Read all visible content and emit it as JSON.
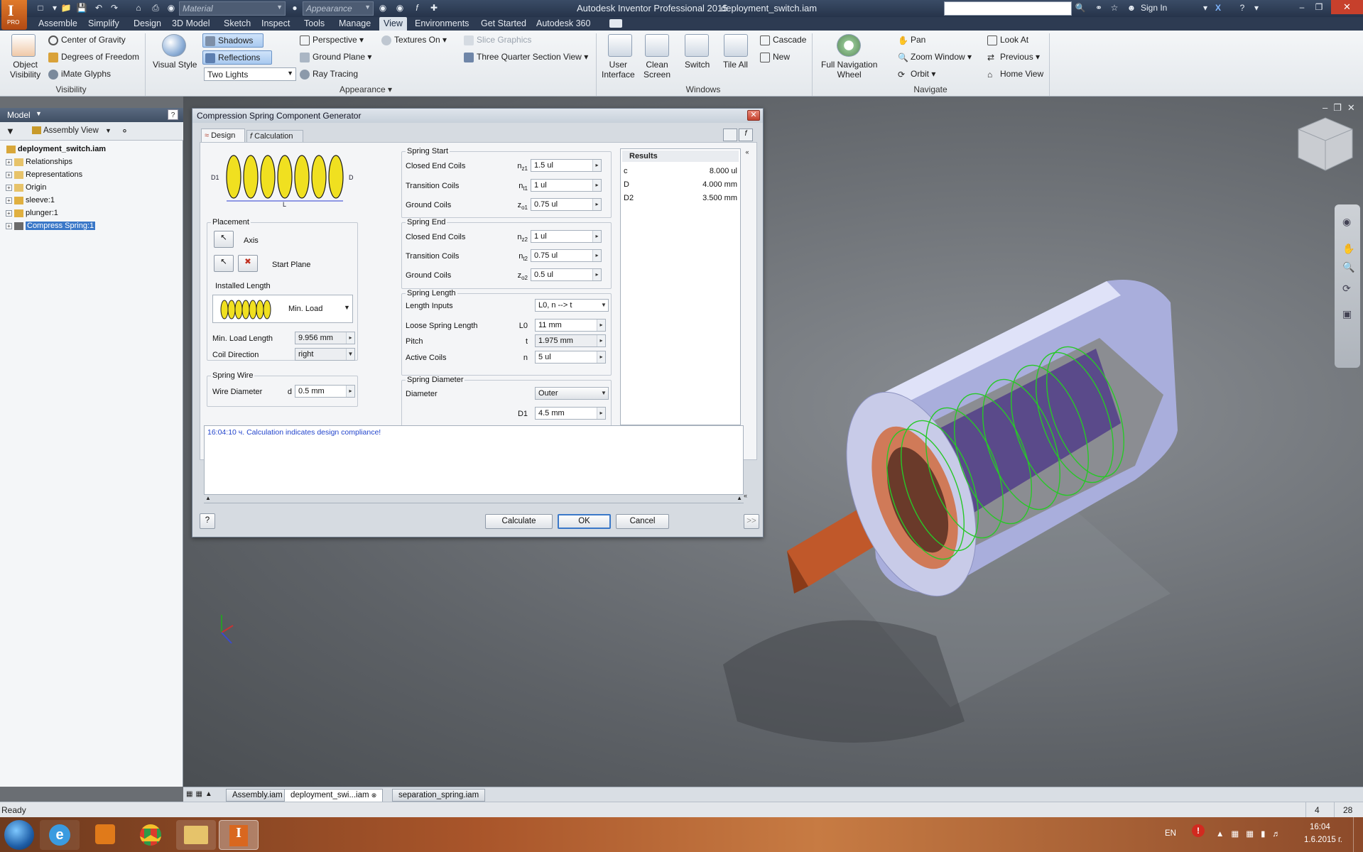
{
  "titlebar": {
    "app_title": "Autodesk Inventor Professional 2015",
    "file_title": "deployment_switch.iam",
    "material_combo": "Material",
    "appearance_combo": "Appearance",
    "sign_in": "Sign In",
    "pro_badge": "PRO"
  },
  "menu": [
    "Assemble",
    "Simplify",
    "Design",
    "3D Model",
    "Sketch",
    "Inspect",
    "Tools",
    "Manage",
    "View",
    "Environments",
    "Get Started",
    "Autodesk 360"
  ],
  "ribbon": {
    "object_visibility": "Object\nVisibility",
    "center_of_gravity": "Center of Gravity",
    "degrees_of_freedom": "Degrees of Freedom",
    "imate_glyphs": "iMate Glyphs",
    "visibility_group": "Visibility",
    "visual_style": "Visual Style",
    "shadows": "Shadows",
    "reflections": "Reflections",
    "lighting": "Two Lights",
    "perspective": "Perspective",
    "ground_plane": "Ground Plane",
    "ray_tracing": "Ray Tracing",
    "textures_on": "Textures On",
    "slice_graphics": "Slice Graphics",
    "three_quarter": "Three Quarter Section View",
    "appearance_group": "Appearance",
    "user_interface": "User\nInterface",
    "clean_screen": "Clean\nScreen",
    "switch": "Switch",
    "tile_all": "Tile All",
    "cascade": "Cascade",
    "new": "New",
    "windows_group": "Windows",
    "full_nav_wheel": "Full Navigation\nWheel",
    "pan": "Pan",
    "zoom_window": "Zoom Window",
    "orbit": "Orbit",
    "look_at": "Look At",
    "previous": "Previous",
    "home_view": "Home View",
    "navigate_group": "Navigate"
  },
  "browser": {
    "header": "Model",
    "view_mode": "Assembly View",
    "root": "deployment_switch.iam",
    "items": [
      "Relationships",
      "Representations",
      "Origin",
      "sleeve:1",
      "plunger:1",
      "Compress Spring:1"
    ]
  },
  "dialog": {
    "title": "Compression Spring Component Generator",
    "tab_design": "Design",
    "tab_calculation": "Calculation",
    "placement": "Placement",
    "axis": "Axis",
    "start_plane": "Start Plane",
    "installed_length": "Installed Length",
    "min_load": "Min. Load",
    "min_load_length_label": "Min. Load Length",
    "min_load_length_value": "9.956 mm",
    "coil_direction_label": "Coil Direction",
    "coil_direction_value": "right",
    "spring_wire": "Spring Wire",
    "wire_diameter_label": "Wire Diameter",
    "wire_diameter_sym": "d",
    "wire_diameter_value": "0.5 mm",
    "spring_start": "Spring Start",
    "start_rows": [
      {
        "label": "Closed End Coils",
        "sym": "n",
        "sub": "z1",
        "value": "1.5 ul"
      },
      {
        "label": "Transition Coils",
        "sym": "n",
        "sub": "t1",
        "value": "1 ul"
      },
      {
        "label": "Ground Coils",
        "sym": "z",
        "sub": "o1",
        "value": "0.75 ul"
      }
    ],
    "spring_end": "Spring End",
    "end_rows": [
      {
        "label": "Closed End Coils",
        "sym": "n",
        "sub": "z2",
        "value": "1 ul"
      },
      {
        "label": "Transition Coils",
        "sym": "n",
        "sub": "t2",
        "value": "0.75 ul"
      },
      {
        "label": "Ground Coils",
        "sym": "z",
        "sub": "o2",
        "value": "0.5 ul"
      }
    ],
    "spring_length": "Spring Length",
    "length_inputs_label": "Length Inputs",
    "length_inputs_value": "L0, n --> t",
    "loose_length_label": "Loose Spring Length",
    "loose_length_sym": "L0",
    "loose_length_value": "11 mm",
    "pitch_label": "Pitch",
    "pitch_sym": "t",
    "pitch_value": "1.975 mm",
    "active_coils_label": "Active Coils",
    "active_coils_sym": "n",
    "active_coils_value": "5 ul",
    "spring_diameter": "Spring Diameter",
    "diameter_label": "Diameter",
    "diameter_value": "Outer",
    "d1_sym": "D1",
    "d1_value": "4.5 mm",
    "results_title": "Results",
    "results": [
      {
        "sym": "c",
        "value": "8.000 ul"
      },
      {
        "sym": "D",
        "value": "4.000 mm"
      },
      {
        "sym": "D2",
        "value": "3.500 mm"
      }
    ],
    "message": "16:04:10 ч. Calculation indicates design compliance!",
    "btn_calculate": "Calculate",
    "btn_ok": "OK",
    "btn_cancel": "Cancel",
    "btn_more": ">>"
  },
  "doc_tabs": [
    "Assembly.iam",
    "deployment_swi...iam",
    "separation_spring.iam"
  ],
  "status": {
    "text": "Ready",
    "num1": "4",
    "num2": "28"
  },
  "taskbar": {
    "lang": "EN",
    "time": "16:04",
    "date": "1.6.2015 г."
  },
  "colors": {
    "accent": "#3a78c8",
    "spring_yellow": "#f0e020",
    "wireframe_green": "#28c828",
    "copper": "#c0582a"
  }
}
